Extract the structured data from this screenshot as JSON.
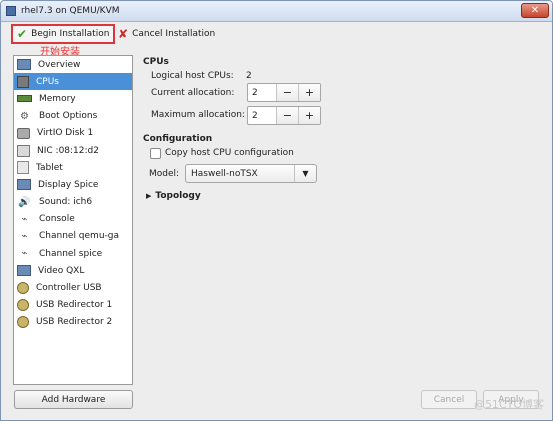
{
  "window": {
    "title": "rhel7.3 on QEMU/KVM",
    "close_label": "✕"
  },
  "toolbar": {
    "begin_label": "Begin Installation",
    "cancel_label": "Cancel Installation",
    "annotation": "开始安装"
  },
  "sidebar": {
    "items": [
      {
        "label": "Overview",
        "icon": "monitor-icon"
      },
      {
        "label": "CPUs",
        "icon": "cpu-icon"
      },
      {
        "label": "Memory",
        "icon": "memory-icon"
      },
      {
        "label": "Boot Options",
        "icon": "gear-icon"
      },
      {
        "label": "VirtIO Disk 1",
        "icon": "disk-icon"
      },
      {
        "label": "NIC :08:12:d2",
        "icon": "nic-icon"
      },
      {
        "label": "Tablet",
        "icon": "tablet-icon"
      },
      {
        "label": "Display Spice",
        "icon": "display-icon"
      },
      {
        "label": "Sound: ich6",
        "icon": "sound-icon"
      },
      {
        "label": "Console",
        "icon": "console-icon"
      },
      {
        "label": "Channel qemu-ga",
        "icon": "channel-icon"
      },
      {
        "label": "Channel spice",
        "icon": "channel-icon"
      },
      {
        "label": "Video QXL",
        "icon": "video-icon"
      },
      {
        "label": "Controller USB",
        "icon": "controller-icon"
      },
      {
        "label": "USB Redirector 1",
        "icon": "usb-icon"
      },
      {
        "label": "USB Redirector 2",
        "icon": "usb-icon"
      }
    ],
    "selected_index": 1,
    "add_hardware_label": "Add Hardware"
  },
  "cpus": {
    "heading": "CPUs",
    "logical_label": "Logical host CPUs:",
    "logical_value": "2",
    "current_label": "Current allocation:",
    "current_value": "2",
    "max_label": "Maximum allocation:",
    "max_value": "2",
    "minus": "−",
    "plus": "+"
  },
  "configuration": {
    "heading": "Configuration",
    "copy_host_label": "Copy host CPU configuration",
    "copy_host_checked": false,
    "model_label": "Model:",
    "model_value": "Haswell-noTSX"
  },
  "topology": {
    "label": "Topology"
  },
  "footer": {
    "cancel_label": "Cancel",
    "apply_label": "Apply",
    "watermark": "@51CTO博客"
  }
}
